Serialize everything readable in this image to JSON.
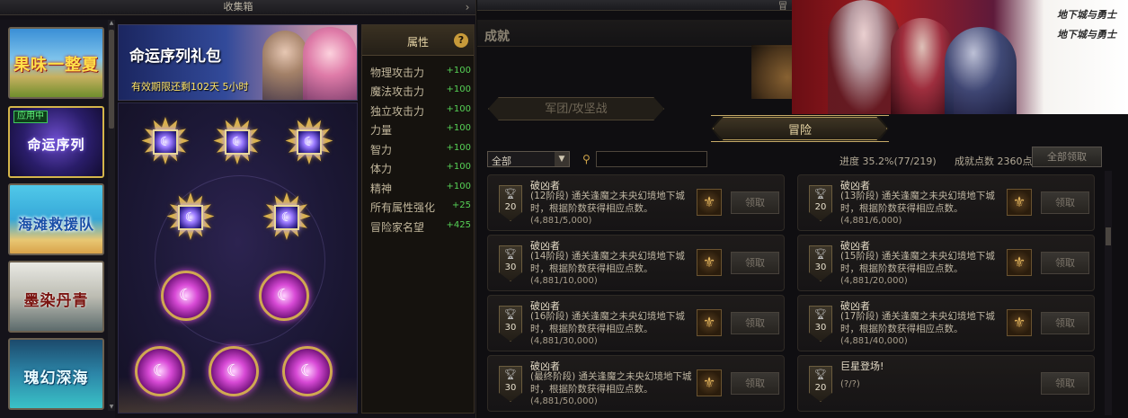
{
  "left_window": {
    "title": "收集箱",
    "close_glyph": "›",
    "items": [
      {
        "label": "果味一整夏"
      },
      {
        "label": "命运序列",
        "badge": "应用中",
        "selected": true
      },
      {
        "label": "海滩救援队"
      },
      {
        "label": "墨染丹青"
      },
      {
        "label": "瑰幻深海"
      }
    ],
    "package": {
      "title": "命运序列礼包",
      "expiry": "有效期限还剩102天 5小时"
    },
    "board": {
      "gold_slots": 5,
      "pink_slots": 5
    },
    "attributes": {
      "header": "属性",
      "help_glyph": "?",
      "rows": [
        {
          "name": "物理攻击力",
          "value": "+100"
        },
        {
          "name": "魔法攻击力",
          "value": "+100"
        },
        {
          "name": "独立攻击力",
          "value": "+100"
        },
        {
          "name": "力量",
          "value": "+100"
        },
        {
          "name": "智力",
          "value": "+100"
        },
        {
          "name": "体力",
          "value": "+100"
        },
        {
          "name": "精神",
          "value": "+100"
        },
        {
          "name": "所有属性强化",
          "value": "+25"
        },
        {
          "name": "冒险家名望",
          "value": "+425"
        }
      ]
    }
  },
  "right_window": {
    "topbar_label": "冒",
    "title": "成就",
    "tabs": {
      "guild": "军团/攻坚战",
      "adventure": "冒险"
    },
    "filter": {
      "selected": "全部",
      "arrow": "▼"
    },
    "search": {
      "placeholder": "",
      "value": ""
    },
    "progress": "进度 35.2%(77/219)",
    "points": "成就点数 2360点",
    "claim_all": "全部领取",
    "cards": [
      {
        "title": "破凶者",
        "desc": "(12阶段) 通关逢魔之未央幻境地下城时，根据阶数获得相应点数。",
        "progress": "(4,881/5,000)",
        "score": "20",
        "claim": "领取",
        "has_reward": true
      },
      {
        "title": "破凶者",
        "desc": "(13阶段) 通关逢魔之未央幻境地下城时，根据阶数获得相应点数。",
        "progress": "(4,881/6,000)",
        "score": "20",
        "claim": "领取",
        "has_reward": true
      },
      {
        "title": "破凶者",
        "desc": "(14阶段) 通关逢魔之未央幻境地下城时，根据阶数获得相应点数。",
        "progress": "(4,881/10,000)",
        "score": "30",
        "claim": "领取",
        "has_reward": true
      },
      {
        "title": "破凶者",
        "desc": "(15阶段) 通关逢魔之未央幻境地下城时，根据阶数获得相应点数。",
        "progress": "(4,881/20,000)",
        "score": "30",
        "claim": "领取",
        "has_reward": true
      },
      {
        "title": "破凶者",
        "desc": "(16阶段) 通关逢魔之未央幻境地下城时，根据阶数获得相应点数。",
        "progress": "(4,881/30,000)",
        "score": "30",
        "claim": "领取",
        "has_reward": true
      },
      {
        "title": "破凶者",
        "desc": "(17阶段) 通关逢魔之未央幻境地下城时，根据阶数获得相应点数。",
        "progress": "(4,881/40,000)",
        "score": "30",
        "claim": "领取",
        "has_reward": true
      },
      {
        "title": "破凶者",
        "desc": "(最终阶段) 通关逢魔之未央幻境地下城时，根据阶数获得相应点数。",
        "progress": "(4,881/50,000)",
        "score": "30",
        "claim": "领取",
        "has_reward": true
      },
      {
        "title": "巨星登场!",
        "desc": "",
        "progress": "(?/?)",
        "score": "20",
        "claim": "领取",
        "has_reward": false
      }
    ]
  },
  "overlay": {
    "logo_lines": [
      "地下城与勇士",
      "地下城与勇士"
    ]
  },
  "icons": {
    "trophy": "trophy-icon",
    "reward": "reward-medal-icon",
    "search": "search-icon",
    "help": "help-icon"
  }
}
